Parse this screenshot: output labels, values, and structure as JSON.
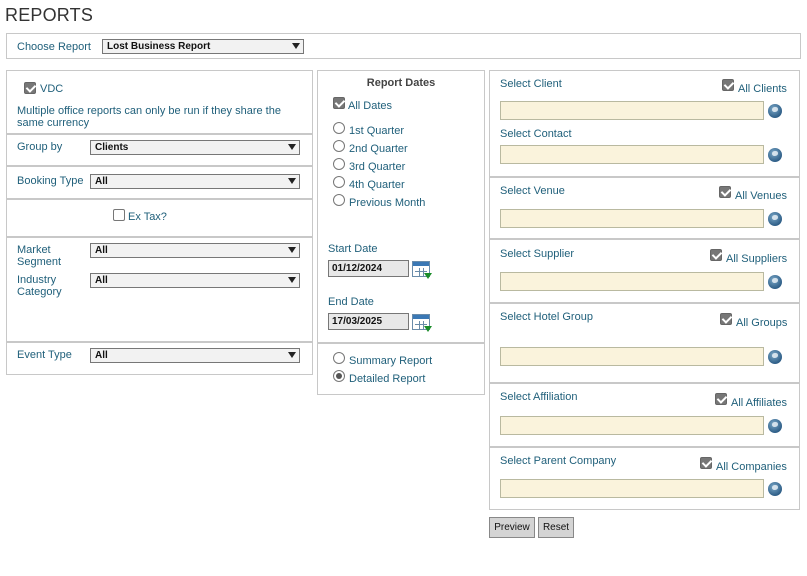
{
  "page": {
    "title": "REPORTS"
  },
  "choose_report": {
    "label": "Choose Report",
    "selected": "Lost Business Report"
  },
  "vdc": {
    "label": "VDC",
    "checked": true,
    "note": "Multiple office reports can only be run if they share the same currency"
  },
  "group_by": {
    "label": "Group by",
    "selected": "Clients"
  },
  "booking_type": {
    "label": "Booking Type",
    "selected": "All"
  },
  "ex_tax": {
    "label": "Ex Tax?",
    "checked": false
  },
  "market_segment": {
    "label_line1": "Market",
    "label_line2": "Segment",
    "selected": "All"
  },
  "industry_category": {
    "label_line1": "Industry",
    "label_line2": "Category",
    "selected": "All"
  },
  "event_type": {
    "label": "Event Type",
    "selected": "All"
  },
  "report_dates": {
    "heading": "Report Dates",
    "all_dates_label": "All Dates",
    "all_dates_checked": true,
    "options": [
      "1st Quarter",
      "2nd Quarter",
      "3rd Quarter",
      "4th Quarter",
      "Previous Month"
    ],
    "start_date_label": "Start Date",
    "start_date": "01/12/2024",
    "end_date_label": "End Date",
    "end_date": "17/03/2025"
  },
  "report_mode": {
    "summary_label": "Summary Report",
    "detailed_label": "Detailed Report",
    "selected": "Detailed Report"
  },
  "selectors": {
    "client": {
      "label": "Select Client",
      "all_label": "All Clients",
      "all_checked": true,
      "value": ""
    },
    "contact": {
      "label": "Select Contact",
      "value": ""
    },
    "venue": {
      "label": "Select Venue",
      "all_label": "All Venues",
      "all_checked": true,
      "value": ""
    },
    "supplier": {
      "label": "Select Supplier",
      "all_label": "All Suppliers",
      "all_checked": true,
      "value": ""
    },
    "hotel_group": {
      "label": "Select Hotel Group",
      "all_label": "All Groups",
      "all_checked": true,
      "value": ""
    },
    "affiliation": {
      "label": "Select Affiliation",
      "all_label": "All Affiliates",
      "all_checked": true,
      "value": ""
    },
    "parent_company": {
      "label": "Select Parent Company",
      "all_label": "All Companies",
      "all_checked": true,
      "value": ""
    }
  },
  "actions": {
    "preview_label": "Preview",
    "reset_label": "Reset"
  },
  "icons": {
    "lookup": "globe-icon",
    "calendar": "calendar-icon"
  },
  "colors": {
    "label_text": "#1f5f7a",
    "field_bg": "#faf3dc",
    "border": "#c8c8c8"
  }
}
